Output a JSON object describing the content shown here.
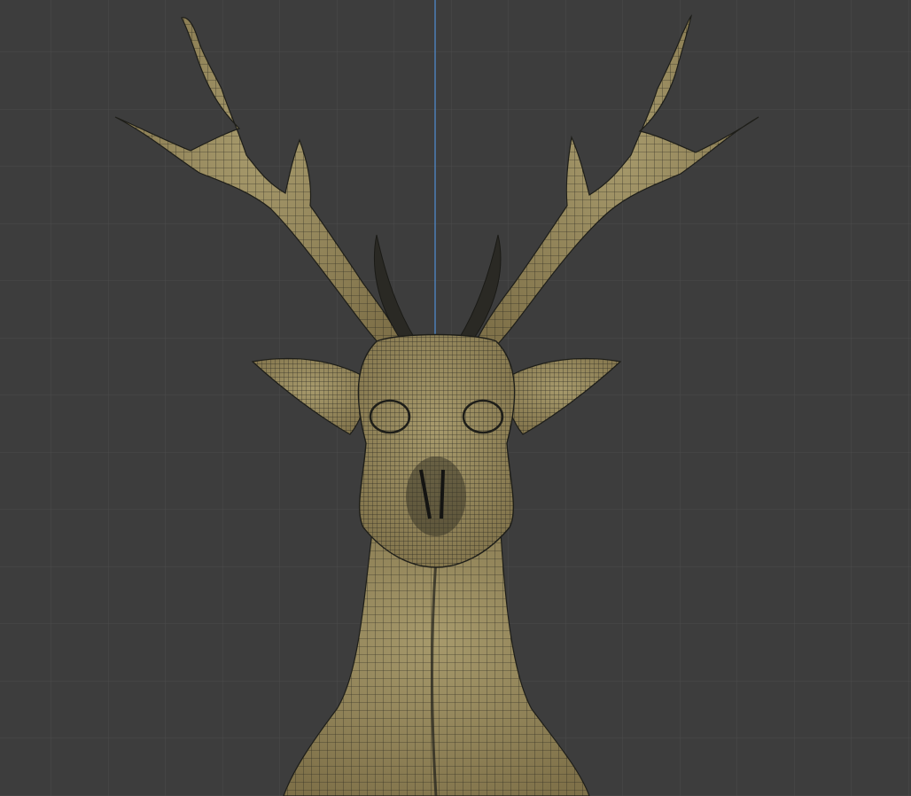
{
  "viewport": {
    "mode": "3d-viewport",
    "shading": "wireframe-overlay",
    "view": "front-orthographic"
  },
  "scene": {
    "object": "deer-head-mesh"
  },
  "colors": {
    "background": "#3d3d3d",
    "grid_line": "#4b4b4b",
    "axis_z": "#4f8fd4",
    "mesh_fill": "#8f8055",
    "mesh_fill_light": "#a79a6c",
    "wire": "#1e1e19"
  }
}
